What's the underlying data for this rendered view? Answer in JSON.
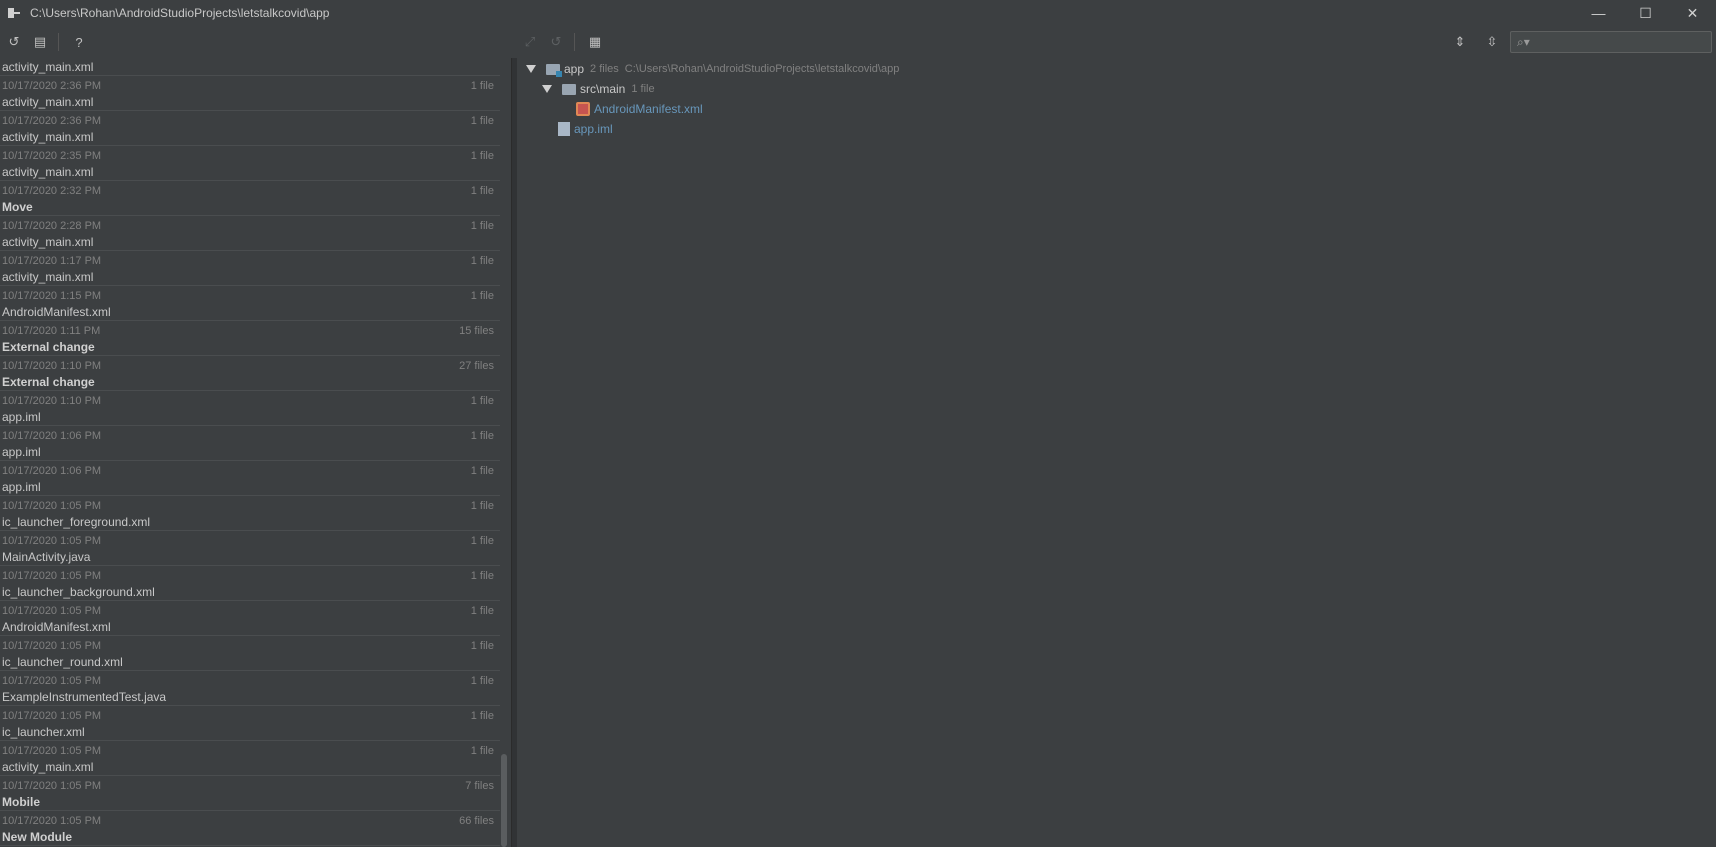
{
  "window": {
    "title": "C:\\Users\\Rohan\\AndroidStudioProjects\\letstalkcovid\\app",
    "minimize": "—",
    "maximize": "☐",
    "close": "✕"
  },
  "toolbar": {
    "revert_icon": "↺",
    "label_icon": "▤",
    "help_icon": "?",
    "right_revert_icon": "↺",
    "group_icon": "▦",
    "expand_icon": "⇕",
    "collapse_icon": "⇳",
    "search_icon": "🔍"
  },
  "history": {
    "first_name": "activity_main.xml",
    "entries": [
      {
        "time": "10/17/2020 2:36 PM",
        "count": "1 file",
        "name": "activity_main.xml",
        "bold": false
      },
      {
        "time": "10/17/2020 2:36 PM",
        "count": "1 file",
        "name": "activity_main.xml",
        "bold": false
      },
      {
        "time": "10/17/2020 2:35 PM",
        "count": "1 file",
        "name": "activity_main.xml",
        "bold": false
      },
      {
        "time": "10/17/2020 2:32 PM",
        "count": "1 file",
        "name": "Move",
        "bold": true
      },
      {
        "time": "10/17/2020 2:28 PM",
        "count": "1 file",
        "name": "activity_main.xml",
        "bold": false
      },
      {
        "time": "10/17/2020 1:17 PM",
        "count": "1 file",
        "name": "activity_main.xml",
        "bold": false
      },
      {
        "time": "10/17/2020 1:15 PM",
        "count": "1 file",
        "name": "AndroidManifest.xml",
        "bold": false
      },
      {
        "time": "10/17/2020 1:11 PM",
        "count": "15 files",
        "name": "External change",
        "bold": true
      },
      {
        "time": "10/17/2020 1:10 PM",
        "count": "27 files",
        "name": "External change",
        "bold": true
      },
      {
        "time": "10/17/2020 1:10 PM",
        "count": "1 file",
        "name": "app.iml",
        "bold": false
      },
      {
        "time": "10/17/2020 1:06 PM",
        "count": "1 file",
        "name": "app.iml",
        "bold": false
      },
      {
        "time": "10/17/2020 1:06 PM",
        "count": "1 file",
        "name": "app.iml",
        "bold": false
      },
      {
        "time": "10/17/2020 1:05 PM",
        "count": "1 file",
        "name": "ic_launcher_foreground.xml",
        "bold": false
      },
      {
        "time": "10/17/2020 1:05 PM",
        "count": "1 file",
        "name": "MainActivity.java",
        "bold": false
      },
      {
        "time": "10/17/2020 1:05 PM",
        "count": "1 file",
        "name": "ic_launcher_background.xml",
        "bold": false
      },
      {
        "time": "10/17/2020 1:05 PM",
        "count": "1 file",
        "name": "AndroidManifest.xml",
        "bold": false
      },
      {
        "time": "10/17/2020 1:05 PM",
        "count": "1 file",
        "name": "ic_launcher_round.xml",
        "bold": false
      },
      {
        "time": "10/17/2020 1:05 PM",
        "count": "1 file",
        "name": "ExampleInstrumentedTest.java",
        "bold": false
      },
      {
        "time": "10/17/2020 1:05 PM",
        "count": "1 file",
        "name": "ic_launcher.xml",
        "bold": false
      },
      {
        "time": "10/17/2020 1:05 PM",
        "count": "1 file",
        "name": "activity_main.xml",
        "bold": false
      },
      {
        "time": "10/17/2020 1:05 PM",
        "count": "7 files",
        "name": "Mobile",
        "bold": true
      },
      {
        "time": "10/17/2020 1:05 PM",
        "count": "66 files",
        "name": "New Module",
        "bold": true
      }
    ]
  },
  "tree": {
    "root_name": "app",
    "root_count": "2 files",
    "root_path": "C:\\Users\\Rohan\\AndroidStudioProjects\\letstalkcovid\\app",
    "src_name": "src\\main",
    "src_count": "1 file",
    "manifest_name": "AndroidManifest.xml",
    "iml_name": "app.iml"
  }
}
